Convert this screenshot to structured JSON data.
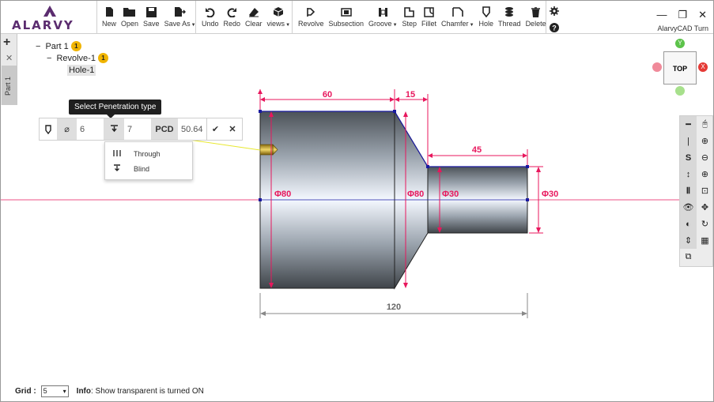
{
  "toolbar": {
    "logo": "ALARVY",
    "file": [
      {
        "label": "New",
        "icon": "new-file-icon"
      },
      {
        "label": "Open",
        "icon": "open-folder-icon"
      },
      {
        "label": "Save",
        "icon": "save-icon"
      },
      {
        "label": "Save As",
        "icon": "save-as-icon"
      }
    ],
    "edit": [
      {
        "label": "Undo",
        "icon": "undo-icon"
      },
      {
        "label": "Redo",
        "icon": "redo-icon"
      },
      {
        "label": "Clear",
        "icon": "eraser-icon"
      },
      {
        "label": "views",
        "icon": "cube-icon"
      }
    ],
    "features": [
      {
        "label": "Revolve",
        "icon": "revolve-icon"
      },
      {
        "label": "Subsection",
        "icon": "subsection-icon"
      },
      {
        "label": "Groove",
        "icon": "groove-icon"
      },
      {
        "label": "Step",
        "icon": "step-icon"
      },
      {
        "label": "Fillet",
        "icon": "fillet-icon"
      },
      {
        "label": "Chamfer",
        "icon": "chamfer-icon"
      },
      {
        "label": "Hole",
        "icon": "hole-icon"
      },
      {
        "label": "Thread",
        "icon": "thread-icon"
      },
      {
        "label": "Delete",
        "icon": "trash-icon"
      }
    ],
    "app_title": "AlarvyCAD Turn"
  },
  "side_tab": {
    "label": "Part 1"
  },
  "tree": {
    "part": {
      "label": "Part 1",
      "count": "1"
    },
    "revolve": {
      "label": "Revolve-1",
      "count": "1"
    },
    "hole": {
      "label": "Hole-1"
    }
  },
  "hole_popup": {
    "tooltip": "Select Penetration type",
    "diameter": "6",
    "depth": "7",
    "pcd_label": "PCD",
    "pcd_value": "50.64",
    "options": [
      {
        "label": "Through",
        "icon": "through-icon"
      },
      {
        "label": "Blind",
        "icon": "blind-icon"
      }
    ]
  },
  "nav_cube": {
    "face": "TOP",
    "y_label": "Y",
    "x_label": "X"
  },
  "drawing": {
    "dims": {
      "len_big": "60",
      "len_taper": "15",
      "len_small": "45",
      "len_total": "120",
      "dia_big": "Φ80",
      "dia_taper": "Φ80",
      "dia_small": "Φ30",
      "dia_end": "Φ30"
    },
    "colors": {
      "dimension": "#e8175d",
      "axis": "#e8175d",
      "outline": "#1a1aa0",
      "body": "#8f98a3"
    }
  },
  "status": {
    "grid_label": "Grid :",
    "grid_value": "5",
    "info_label": "Info",
    "info_text": ": Show transparent is turned ON"
  }
}
